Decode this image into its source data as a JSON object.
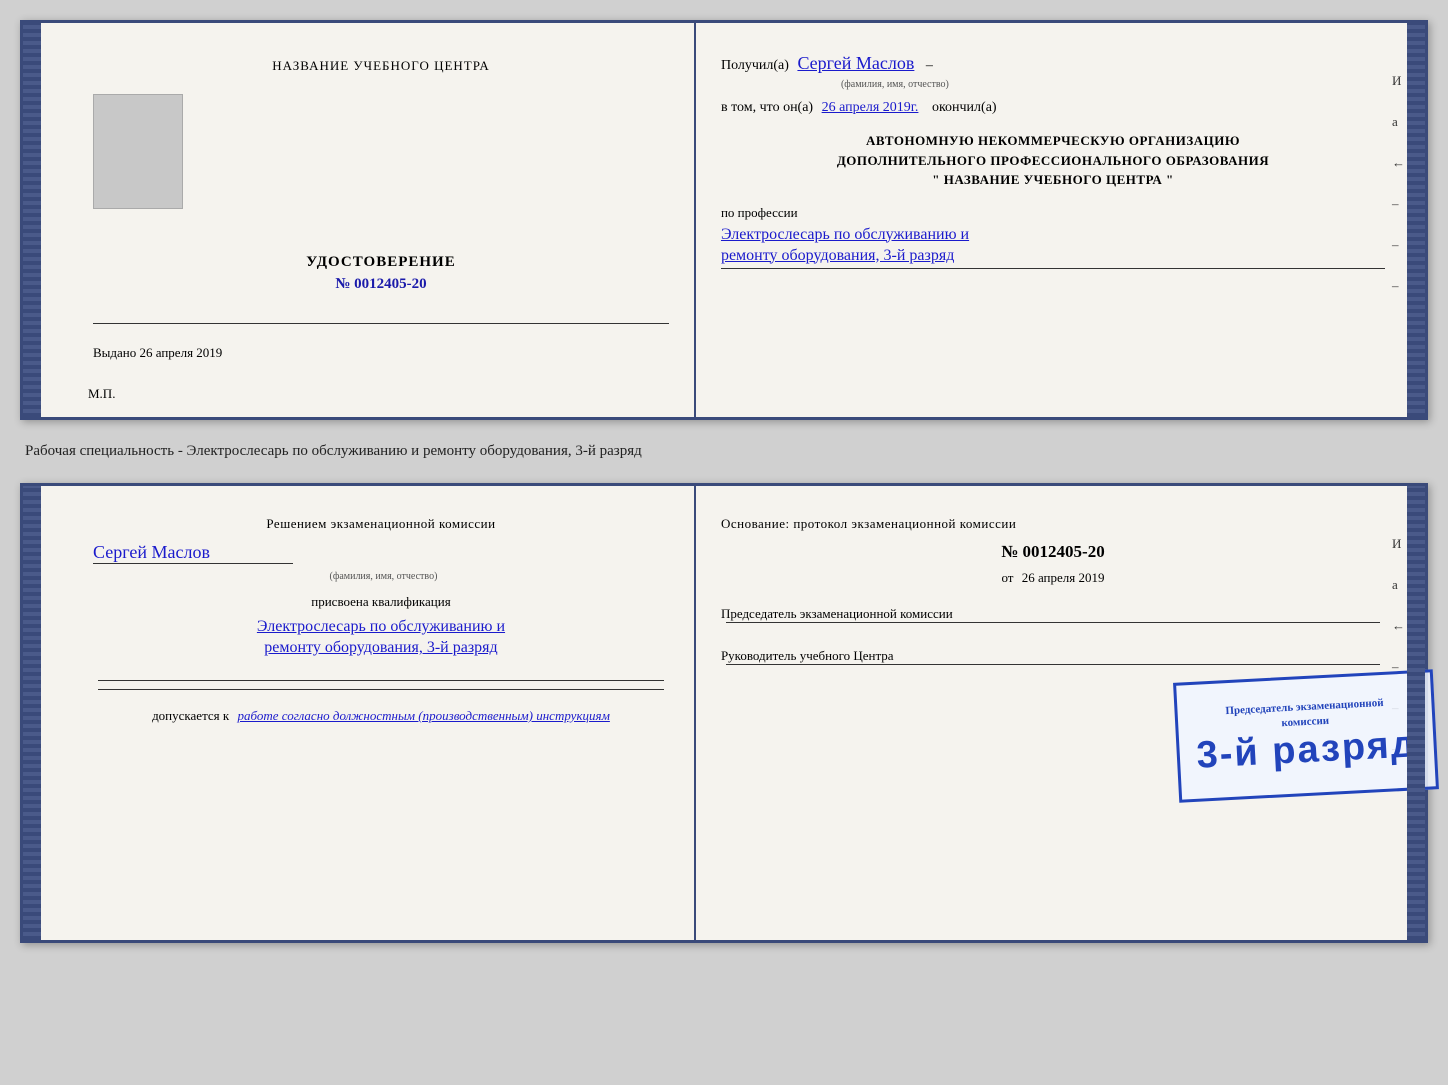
{
  "top_cert": {
    "left": {
      "school_name": "НАЗВАНИЕ УЧЕБНОГО ЦЕНТРА",
      "udostoverenie_label": "УДОСТОВЕРЕНИЕ",
      "cert_number": "№ 0012405-20",
      "vydano_label": "Выдано",
      "vydano_date": "26 апреля 2019",
      "mp_label": "М.П."
    },
    "right": {
      "poluchil_prefix": "Получил(а)",
      "poluchil_name": "Сергей Маслов",
      "fio_label": "(фамилия, имя, отчество)",
      "dash": "–",
      "vtom_prefix": "в том, что он(а)",
      "vtom_date": "26 апреля 2019г.",
      "okoncil_label": "окончил(а)",
      "org_line1": "АВТОНОМНУЮ НЕКОММЕРЧЕСКУЮ ОРГАНИЗАЦИЮ",
      "org_line2": "ДОПОЛНИТЕЛЬНОГО ПРОФЕССИОНАЛЬНОГО ОБРАЗОВАНИЯ",
      "org_line3": "\"   НАЗВАНИЕ УЧЕБНОГО ЦЕНТРА   \"",
      "po_professii": "по профессии",
      "profession1": "Электрослесарь по обслуживанию и",
      "profession2": "ремонту оборудования, 3-й разряд"
    }
  },
  "between_text": "Рабочая специальность - Электрослесарь по обслуживанию и ремонту оборудования, 3-й разряд",
  "bottom_cert": {
    "left": {
      "resheniem": "Решением экзаменационной комиссии",
      "person_name": "Сергей Маслов",
      "fio_label": "(фамилия, имя, отчество)",
      "prisvoena": "присвоена квалификация",
      "kvalif1": "Электрослесарь по обслуживанию и",
      "kvalif2": "ремонту оборудования, 3-й разряд",
      "dopuskaetsya": "допускается к",
      "dopusk_text": "работе согласно должностным (производственным) инструкциям"
    },
    "right": {
      "osnovanie": "Основание: протокол экзаменационной комиссии",
      "number_label": "№  0012405-20",
      "ot_label": "от",
      "ot_date": "26 апреля 2019",
      "predsedatel_label": "Председатель экзаменационной комиссии",
      "rukovoditel_label": "Руководитель учебного Центра"
    },
    "stamp": {
      "small_text": "Председатель экзаменационной\nкомиссии",
      "big_text": "3-й разряд"
    }
  },
  "right_side_letters": [
    "И",
    "а",
    "←",
    "–",
    "–",
    "–",
    "–"
  ]
}
